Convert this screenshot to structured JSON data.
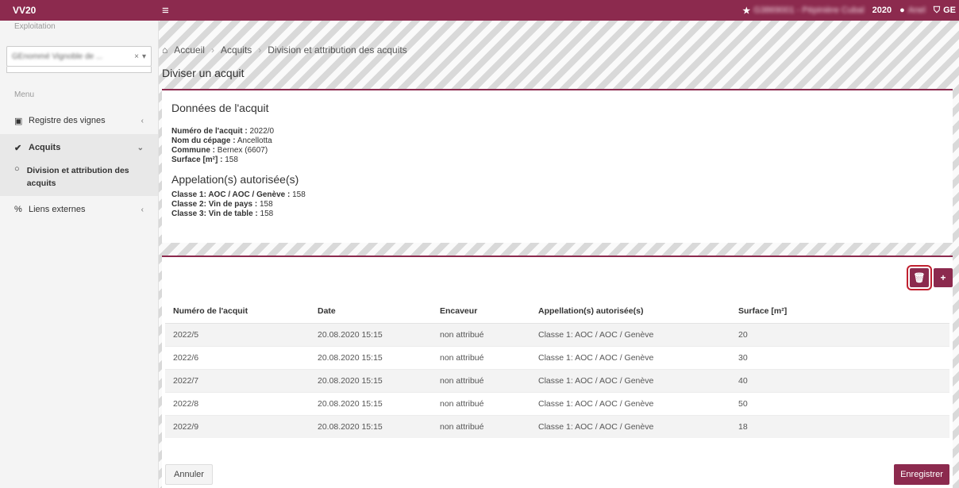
{
  "topbar": {
    "brand": "VV20",
    "exploitation_blurred": "G3869001 - Pépinière Cubal",
    "year": "2020",
    "user_blurred": "Anel",
    "canton": "GE"
  },
  "sidebar": {
    "exploitation_label": "Exploitation",
    "exploitation_value": "GEnommé Vignoble de ...",
    "menu_label": "Menu",
    "items": [
      {
        "label": "Registre des vignes"
      },
      {
        "label": "Acquits"
      },
      {
        "label": "Division et attribution des acquits"
      },
      {
        "label": "Liens externes"
      }
    ]
  },
  "breadcrumb": {
    "home": "Accueil",
    "level2": "Acquits",
    "level3": "Division et attribution des acquits"
  },
  "page_title": "Diviser un acquit",
  "acquit": {
    "heading": "Données de l'acquit",
    "numero_label": "Numéro de l'acquit :",
    "numero_value": "2022/0",
    "cepage_label": "Nom du cépage :",
    "cepage_value": "Ancellotta",
    "commune_label": "Commune :",
    "commune_value": "Bernex (6607)",
    "surface_label": "Surface [m²] :",
    "surface_value": "158",
    "appellations_heading": "Appelation(s) autorisée(s)",
    "classes": [
      {
        "label": "Classe 1: AOC / AOC / Genève :",
        "value": "158"
      },
      {
        "label": "Classe 2: Vin de pays :",
        "value": "158"
      },
      {
        "label": "Classe 3: Vin de table :",
        "value": "158"
      }
    ]
  },
  "table": {
    "headers": [
      "Numéro de l'acquit",
      "Date",
      "Encaveur",
      "Appellation(s) autorisée(s)",
      "Surface [m²]",
      ""
    ],
    "rows": [
      [
        "2022/5",
        "20.08.2020 15:15",
        "non attribué",
        "Classe 1: AOC / AOC / Genève",
        "20"
      ],
      [
        "2022/6",
        "20.08.2020 15:15",
        "non attribué",
        "Classe 1: AOC / AOC / Genève",
        "30"
      ],
      [
        "2022/7",
        "20.08.2020 15:15",
        "non attribué",
        "Classe 1: AOC / AOC / Genève",
        "40"
      ],
      [
        "2022/8",
        "20.08.2020 15:15",
        "non attribué",
        "Classe 1: AOC / AOC / Genève",
        "50"
      ],
      [
        "2022/9",
        "20.08.2020 15:15",
        "non attribué",
        "Classe 1: AOC / AOC / Genève",
        "18"
      ]
    ]
  },
  "buttons": {
    "cancel": "Annuler",
    "save": "Enregistrer"
  },
  "colors": {
    "brand": "#8c2a4e",
    "highlight": "#c0202f"
  }
}
